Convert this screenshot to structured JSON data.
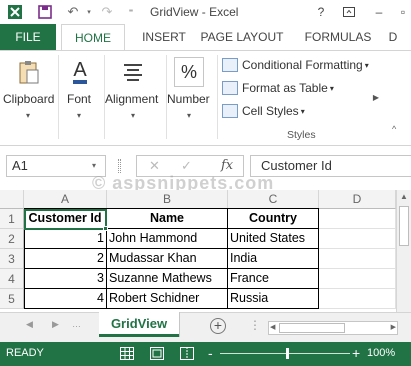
{
  "titlebar": {
    "title": "GridView - Excel",
    "help": "?",
    "quick_access_icons": [
      "excel-logo-icon",
      "save-icon",
      "undo-icon",
      "redo-icon",
      "customize-icon"
    ]
  },
  "tabs": [
    "FILE",
    "HOME",
    "INSERT",
    "PAGE LAYOUT",
    "FORMULAS",
    "D"
  ],
  "ribbon": {
    "clipboard": "Clipboard",
    "font": "Font",
    "alignment": "Alignment",
    "number": "Number",
    "number_icon_glyph": "%",
    "font_icon_glyph": "A",
    "styles_items": [
      "Conditional Formatting",
      "Format as Table",
      "Cell Styles"
    ],
    "styles_group": "Styles"
  },
  "formula_bar": {
    "name_box": "A1",
    "fx_glyph": "fx",
    "value": "Customer Id"
  },
  "watermark": "© aspsnippets.com",
  "sheet": {
    "columns": [
      "A",
      "B",
      "C",
      "D"
    ],
    "rows": [
      "1",
      "2",
      "3",
      "4",
      "5"
    ],
    "cells": [
      [
        "Customer Id",
        "Name",
        "Country",
        ""
      ],
      [
        "1",
        "John Hammond",
        "United States",
        ""
      ],
      [
        "2",
        "Mudassar Khan",
        "India",
        ""
      ],
      [
        "3",
        "Suzanne Mathews",
        "France",
        ""
      ],
      [
        "4",
        "Robert Schidner",
        "Russia",
        ""
      ]
    ],
    "active_cell": "A1"
  },
  "sheet_tabs": {
    "active": "GridView",
    "add_glyph": "+"
  },
  "status_bar": {
    "status": "READY",
    "zoom_level": "100%",
    "zoom_minus": "-",
    "zoom_plus": "+"
  },
  "colors": {
    "accent": "#217346",
    "grid_line": "#e1e1e1",
    "header_bg": "#f3f3f3"
  }
}
